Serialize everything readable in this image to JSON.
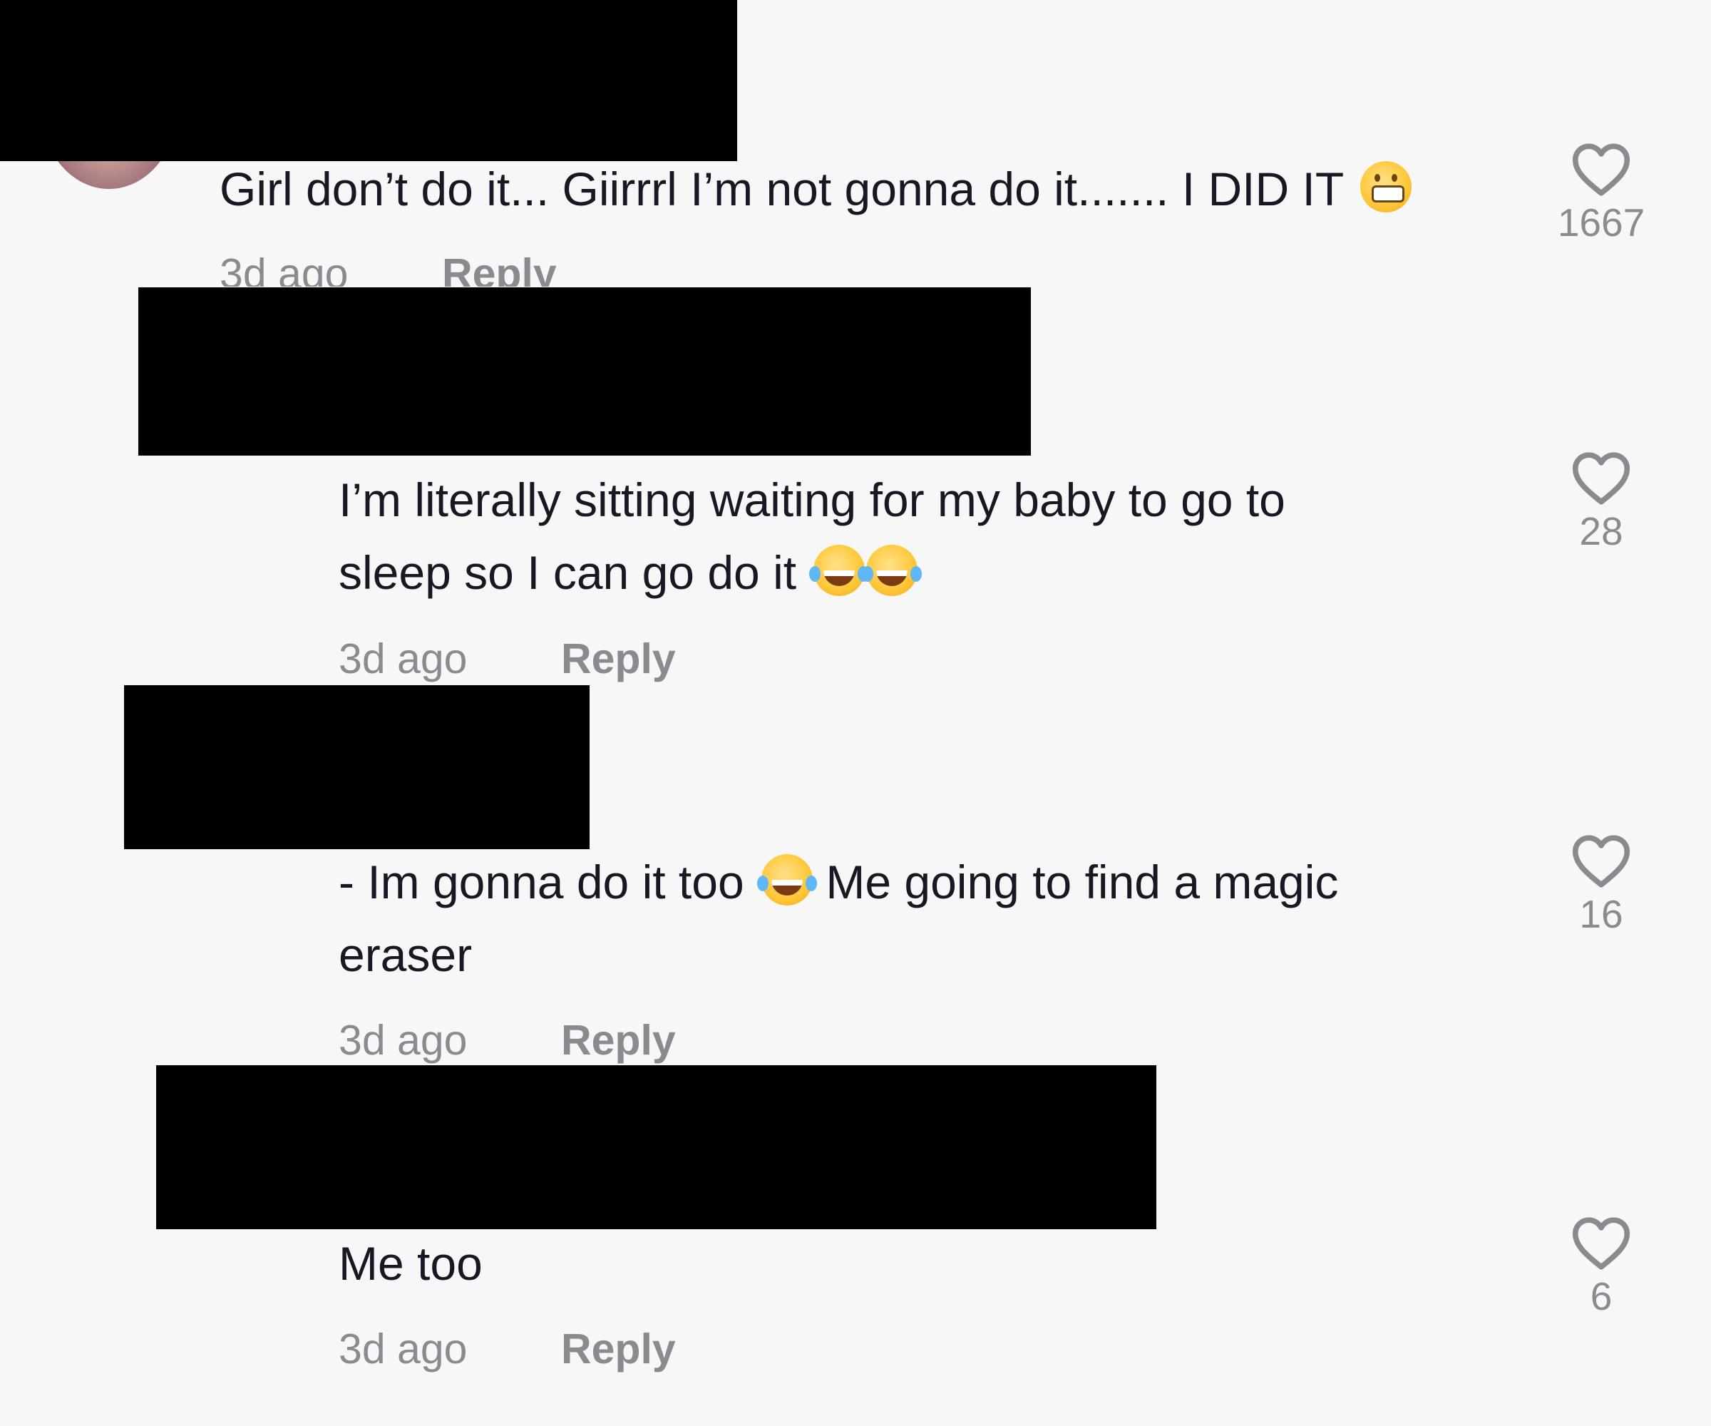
{
  "colors": {
    "background": "#f7f7f7",
    "text": "#161823",
    "secondary_text": "#8a8b91",
    "redaction": "#000000"
  },
  "comments": [
    {
      "text": "Girl don’t do it... Giirrrl I’m not gonna do it....... I DID IT",
      "emoji": "grimacing-face",
      "time": "3d ago",
      "reply_label": "Reply",
      "likes": "1667"
    },
    {
      "line1": "I’m literally sitting waiting for my baby to go to",
      "line2": "sleep so I can go do it",
      "emoji": "face-with-tears-of-joy x2",
      "time": "3d ago",
      "reply_label": "Reply",
      "likes": "28"
    },
    {
      "line1_a": "- Im gonna do it too",
      "line1_b": "Me going to find a magic",
      "line2": "eraser",
      "emoji": "face-with-tears-of-joy",
      "time": "3d ago",
      "reply_label": "Reply",
      "likes": "16"
    },
    {
      "text": "Me too",
      "time": "3d ago",
      "reply_label": "Reply",
      "likes": "6"
    }
  ]
}
